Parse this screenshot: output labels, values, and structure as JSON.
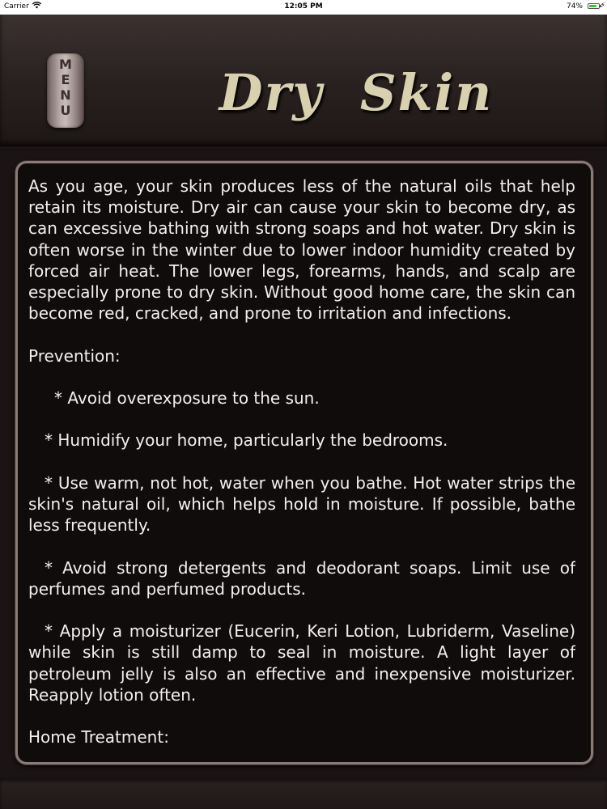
{
  "status_bar": {
    "carrier": "Carrier",
    "time": "12:05 PM",
    "battery": "74%"
  },
  "header": {
    "menu_label": [
      "M",
      "E",
      "N",
      "U"
    ],
    "title": "Dry Skin"
  },
  "content": {
    "intro": "As you age, your skin produces less of the natural oils that help retain its moisture. Dry air can cause your skin to become dry, as can excessive bathing with strong soaps and hot water. Dry skin is often worse in the winter due to lower indoor humidity created by forced air heat. The lower legs, forearms, hands, and scalp are especially prone to dry skin. Without good home care, the skin can become red, cracked, and prone to irritation and infections.",
    "prevention_heading": "Prevention:",
    "prevention_items": [
      "* Avoid overexposure to the sun.",
      "* Humidify your home, particularly the bedrooms.",
      "* Use warm, not hot, water when you bathe. Hot water strips the skin's natural oil, which helps hold in moisture. If possible, bathe less frequently.",
      "* Avoid strong detergents and deodorant soaps. Limit use of perfumes and perfumed products.",
      "* Apply a moisturizer (Eucerin, Keri Lotion, Lubriderm, Vaseline) while skin is still damp to seal in moisture. A light layer of petroleum jelly is also an effective and inexpensive moisturizer. Reapply lotion often."
    ],
    "treatment_heading": "Home Treatment:"
  }
}
